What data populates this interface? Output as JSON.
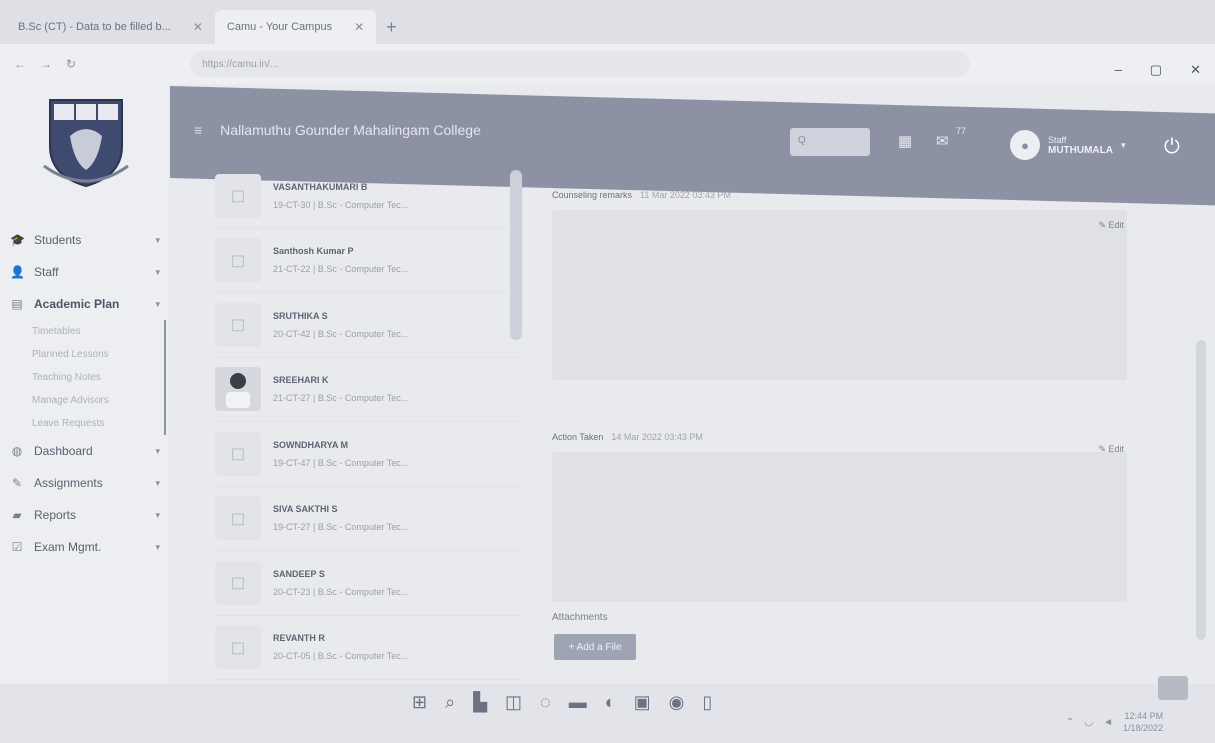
{
  "browser": {
    "tabs": [
      {
        "label": "B.Sc (CT) - Data to be filled b...",
        "active": false
      },
      {
        "label": "Camu - Your Campus",
        "active": true
      }
    ],
    "url": "https://camu.in/..."
  },
  "header": {
    "college_name": "Nallamuthu Gounder Mahalingam College",
    "search_placeholder": "Q",
    "mail_count": "77",
    "user_role": "Staff",
    "user_name": "MUTHUMALA"
  },
  "sidebar": {
    "items": [
      {
        "label": "Students",
        "icon": "graduation-cap-icon"
      },
      {
        "label": "Staff",
        "icon": "user-icon"
      },
      {
        "label": "Academic Plan",
        "icon": "clipboard-icon"
      }
    ],
    "subitems": [
      "Timetables",
      "Planned Lessons",
      "Teaching Notes",
      "Manage Advisors",
      "Leave Requests"
    ],
    "more_items": [
      {
        "label": "Dashboard",
        "icon": "dashboard-icon"
      },
      {
        "label": "Assignments",
        "icon": "assignment-icon"
      },
      {
        "label": "Reports",
        "icon": "folder-icon"
      },
      {
        "label": "Exam Mgmt.",
        "icon": "exam-icon"
      }
    ]
  },
  "students": [
    {
      "name": "VASANTHAKUMARI B",
      "detail": "19-CT-30 | B.Sc - Computer Tec..."
    },
    {
      "name": "Santhosh Kumar P",
      "detail": "21-CT-22 | B.Sc - Computer Tec..."
    },
    {
      "name": "SRUTHIKA S",
      "detail": "20-CT-42 | B.Sc - Computer Tec..."
    },
    {
      "name": "SREEHARI K",
      "detail": "21-CT-27 | B.Sc - Computer Tec..."
    },
    {
      "name": "SOWNDHARYA M",
      "detail": "19-CT-47 | B.Sc - Computer Tec..."
    },
    {
      "name": "SIVA SAKTHI S",
      "detail": "19-CT-27 | B.Sc - Computer Tec..."
    },
    {
      "name": "SANDEEP S",
      "detail": "20-CT-23 | B.Sc - Computer Tec..."
    },
    {
      "name": "REVANTH R",
      "detail": "20-CT-05 | B.Sc - Computer Tec..."
    }
  ],
  "panel": {
    "counseling_title": "Counseling remarks",
    "counseling_time": "11 Mar 2022 03:43 PM",
    "edit_label": "Edit",
    "counseling_text": "",
    "action_title": "Action Taken",
    "action_time": "14 Mar 2022 03:43 PM",
    "action_text": "",
    "attachments_label": "Attachments",
    "add_file_label": "+ Add a File"
  },
  "taskbar": {
    "time": "12:44 PM",
    "date": "1/18/2022"
  }
}
